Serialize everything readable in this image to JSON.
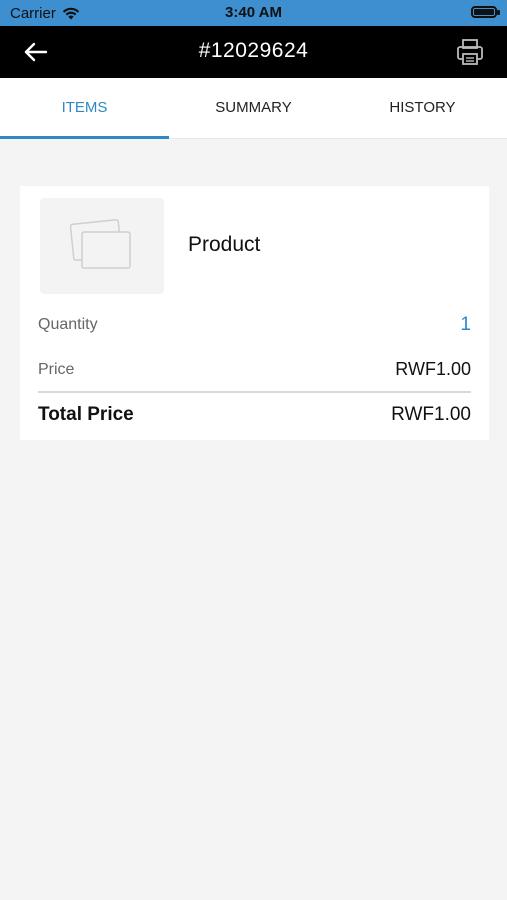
{
  "status_bar": {
    "carrier": "Carrier",
    "time": "3:40 AM",
    "icons": [
      "wifi-icon",
      "battery-icon"
    ]
  },
  "navbar": {
    "title": "#12029624",
    "back_icon": "back-arrow-icon",
    "print_icon": "printer-icon"
  },
  "tabs": [
    {
      "label": "ITEMS",
      "active": true
    },
    {
      "label": "SUMMARY",
      "active": false
    },
    {
      "label": "HISTORY",
      "active": false
    }
  ],
  "item": {
    "name": "Product",
    "image_icon": "image-placeholder-icon",
    "quantity_label": "Quantity",
    "quantity": "1",
    "price_label": "Price",
    "price": "RWF1.00",
    "total_label": "Total Price",
    "total": "RWF1.00"
  },
  "colors": {
    "status_bar": "#3d8fd0",
    "navbar": "#000000",
    "accent": "#2f88c5",
    "background": "#f4f4f4"
  }
}
